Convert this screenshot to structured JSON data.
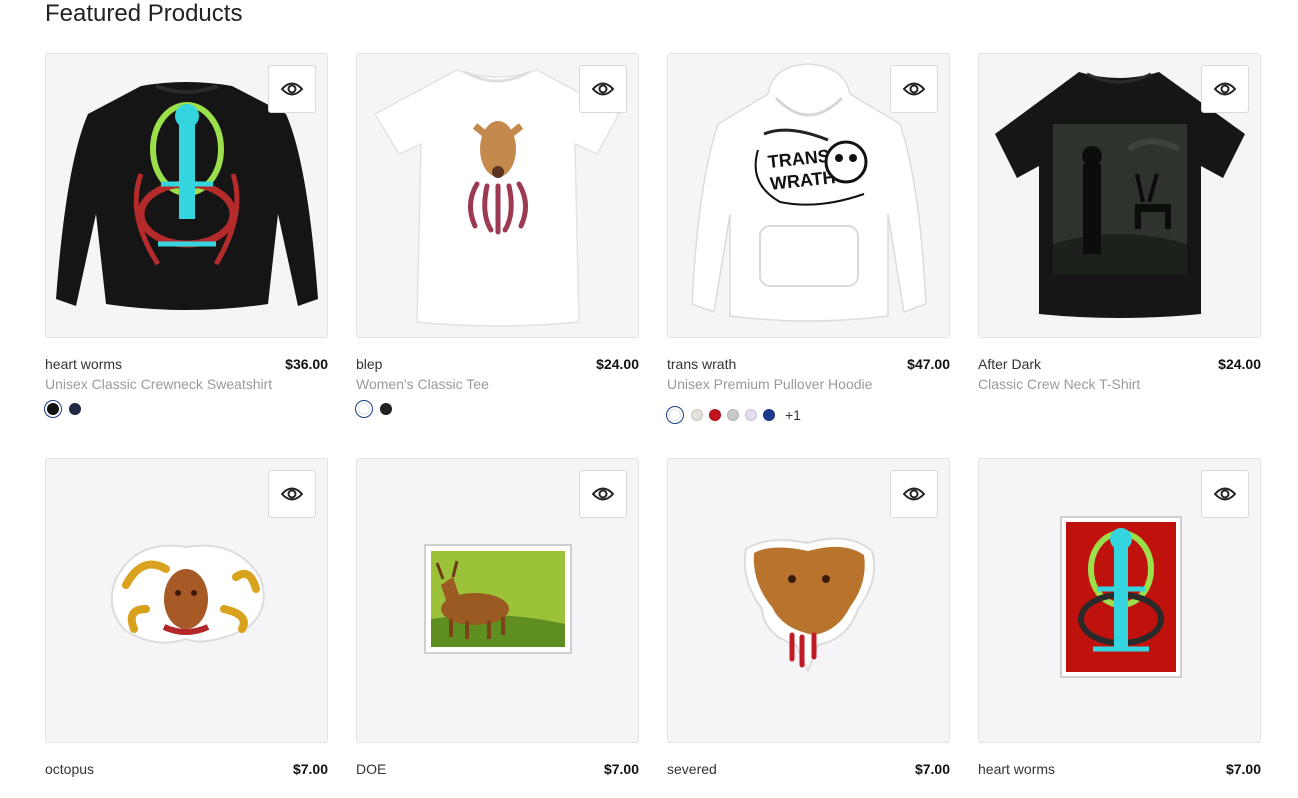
{
  "section": {
    "title": "Featured Products"
  },
  "products": [
    {
      "name": "heart worms",
      "price": "$36.00",
      "type": "Unisex Classic Crewneck Sweatshirt",
      "swatches": [
        "#111111",
        "#1f2a44"
      ],
      "more": ""
    },
    {
      "name": "blep",
      "price": "$24.00",
      "type": "Women's Classic Tee",
      "swatches": [
        "#ffffff",
        "#222222"
      ],
      "more": ""
    },
    {
      "name": "trans wrath",
      "price": "$47.00",
      "type": "Unisex Premium Pullover Hoodie",
      "swatches": [
        "#ffffff",
        "#e6e2da",
        "#c0141c",
        "#c9c9c9",
        "#e5ddf0",
        "#1d3c8f"
      ],
      "more": "+1"
    },
    {
      "name": "After Dark",
      "price": "$24.00",
      "type": "Classic Crew Neck T-Shirt",
      "swatches": [],
      "more": ""
    },
    {
      "name": "octopus",
      "price": "$7.00",
      "type": "",
      "swatches": [],
      "more": ""
    },
    {
      "name": "DOE",
      "price": "$7.00",
      "type": "",
      "swatches": [],
      "more": ""
    },
    {
      "name": "severed",
      "price": "$7.00",
      "type": "",
      "swatches": [],
      "more": ""
    },
    {
      "name": "heart worms",
      "price": "$7.00",
      "type": "",
      "swatches": [],
      "more": ""
    }
  ],
  "icons": {
    "quick_view": "eye-icon"
  }
}
